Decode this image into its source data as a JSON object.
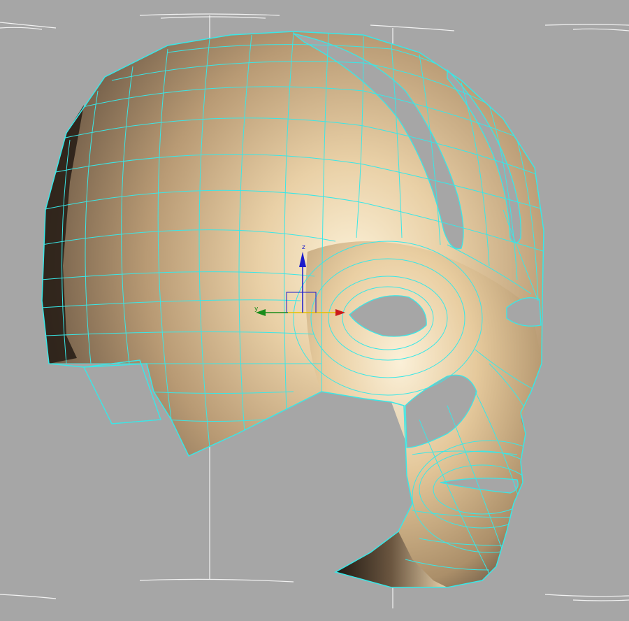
{
  "viewport": {
    "name": "perspective-viewport",
    "background": "#a6a6a6"
  },
  "model": {
    "name": "head-mask-mesh",
    "wire_color": "#39e7e7",
    "skin_light": "#f7e6c6",
    "skin_mid": "#d6b88c",
    "skin_dark": "#4a3c30"
  },
  "gizmo": {
    "z_label": "z",
    "y_label": "y",
    "x_color": "#cc1a1a",
    "y_color": "#1a8c1a",
    "z_color": "#1a1acc",
    "plane_color": "#e6c000"
  }
}
